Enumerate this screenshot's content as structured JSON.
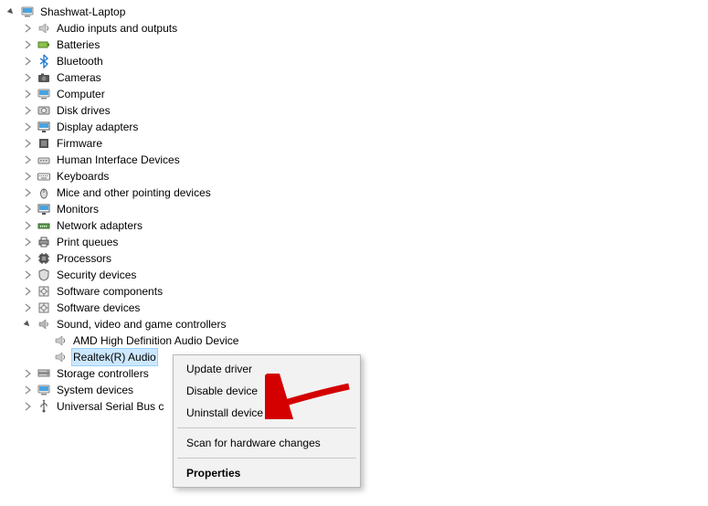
{
  "tree": {
    "root": "Shashwat-Laptop",
    "categories": [
      "Audio inputs and outputs",
      "Batteries",
      "Bluetooth",
      "Cameras",
      "Computer",
      "Disk drives",
      "Display adapters",
      "Firmware",
      "Human Interface Devices",
      "Keyboards",
      "Mice and other pointing devices",
      "Monitors",
      "Network adapters",
      "Print queues",
      "Processors",
      "Security devices",
      "Software components",
      "Software devices"
    ],
    "sound_category": "Sound, video and game controllers",
    "sound_children": [
      "AMD High Definition Audio Device",
      "Realtek(R) Audio"
    ],
    "after_sound": [
      "Storage controllers",
      "System devices",
      "Universal Serial Bus c"
    ]
  },
  "context_menu": {
    "items": [
      "Update driver",
      "Disable device",
      "Uninstall device",
      "Scan for hardware changes",
      "Properties"
    ]
  },
  "selected_device_index": 1
}
